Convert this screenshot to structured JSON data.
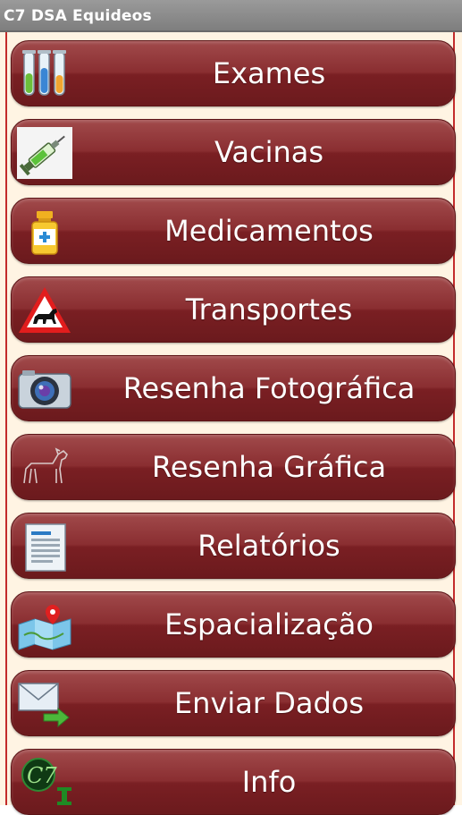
{
  "app": {
    "title": "C7 DSA Equideos"
  },
  "menu": {
    "items": [
      {
        "label": "Exames",
        "icon": "test-tubes-icon"
      },
      {
        "label": "Vacinas",
        "icon": "syringe-icon"
      },
      {
        "label": "Medicamentos",
        "icon": "medicine-bottle-icon"
      },
      {
        "label": "Transportes",
        "icon": "horse-warning-sign-icon"
      },
      {
        "label": "Resenha Fotográfica",
        "icon": "camera-icon"
      },
      {
        "label": "Resenha Gráfica",
        "icon": "horse-sketch-icon"
      },
      {
        "label": "Relatórios",
        "icon": "report-document-icon"
      },
      {
        "label": "Espacialização",
        "icon": "map-pin-icon"
      },
      {
        "label": "Enviar Dados",
        "icon": "envelope-send-icon"
      },
      {
        "label": "Info",
        "icon": "c7-info-logo-icon"
      }
    ]
  },
  "colors": {
    "button": "#8a2e31",
    "background": "#fff4e3",
    "rail": "#c32b2b",
    "titlebar": "#8c8c8c"
  }
}
